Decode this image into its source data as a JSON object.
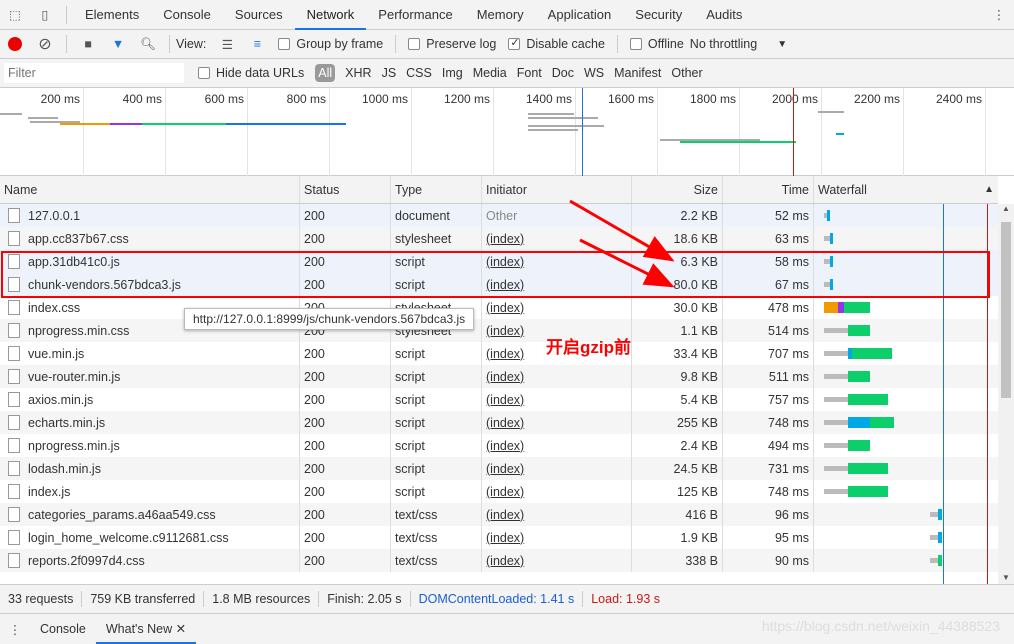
{
  "tabs": [
    "Elements",
    "Console",
    "Sources",
    "Network",
    "Performance",
    "Memory",
    "Application",
    "Security",
    "Audits"
  ],
  "active_tab": "Network",
  "toolbar": {
    "view_label": "View:",
    "group_by_frame": "Group by frame",
    "preserve_log": "Preserve log",
    "disable_cache": "Disable cache",
    "disable_cache_checked": true,
    "offline": "Offline",
    "throttling": "No throttling"
  },
  "filter": {
    "placeholder": "Filter",
    "hide_data_urls": "Hide data URLs",
    "types": [
      "All",
      "XHR",
      "JS",
      "CSS",
      "Img",
      "Media",
      "Font",
      "Doc",
      "WS",
      "Manifest",
      "Other"
    ]
  },
  "overview_ticks": [
    "200 ms",
    "400 ms",
    "600 ms",
    "800 ms",
    "1000 ms",
    "1200 ms",
    "1400 ms",
    "1600 ms",
    "1800 ms",
    "2000 ms",
    "2200 ms",
    "2400 ms"
  ],
  "columns": [
    "Name",
    "Status",
    "Type",
    "Initiator",
    "Size",
    "Time",
    "Waterfall"
  ],
  "rows": [
    {
      "name": "127.0.0.1",
      "status": "200",
      "type": "document",
      "initiator": "Other",
      "size": "2.2 KB",
      "time": "52 ms"
    },
    {
      "name": "app.cc837b67.css",
      "status": "200",
      "type": "stylesheet",
      "initiator": "(index)",
      "size": "18.6 KB",
      "time": "63 ms"
    },
    {
      "name": "app.31db41c0.js",
      "status": "200",
      "type": "script",
      "initiator": "(index)",
      "size": "6.3 KB",
      "time": "58 ms"
    },
    {
      "name": "chunk-vendors.567bdca3.js",
      "status": "200",
      "type": "script",
      "initiator": "(index)",
      "size": "80.0 KB",
      "time": "67 ms"
    },
    {
      "name": "index.css",
      "status": "200",
      "type": "stylesheet",
      "initiator": "(index)",
      "size": "30.0 KB",
      "time": "478 ms"
    },
    {
      "name": "nprogress.min.css",
      "status": "200",
      "type": "stylesheet",
      "initiator": "(index)",
      "size": "1.1 KB",
      "time": "514 ms"
    },
    {
      "name": "vue.min.js",
      "status": "200",
      "type": "script",
      "initiator": "(index)",
      "size": "33.4 KB",
      "time": "707 ms"
    },
    {
      "name": "vue-router.min.js",
      "status": "200",
      "type": "script",
      "initiator": "(index)",
      "size": "9.8 KB",
      "time": "511 ms"
    },
    {
      "name": "axios.min.js",
      "status": "200",
      "type": "script",
      "initiator": "(index)",
      "size": "5.4 KB",
      "time": "757 ms"
    },
    {
      "name": "echarts.min.js",
      "status": "200",
      "type": "script",
      "initiator": "(index)",
      "size": "255 KB",
      "time": "748 ms"
    },
    {
      "name": "nprogress.min.js",
      "status": "200",
      "type": "script",
      "initiator": "(index)",
      "size": "2.4 KB",
      "time": "494 ms"
    },
    {
      "name": "lodash.min.js",
      "status": "200",
      "type": "script",
      "initiator": "(index)",
      "size": "24.5 KB",
      "time": "731 ms"
    },
    {
      "name": "index.js",
      "status": "200",
      "type": "script",
      "initiator": "(index)",
      "size": "125 KB",
      "time": "748 ms"
    },
    {
      "name": "categories_params.a46aa549.css",
      "status": "200",
      "type": "text/css",
      "initiator": "(index)",
      "size": "416 B",
      "time": "96 ms"
    },
    {
      "name": "login_home_welcome.c9112681.css",
      "status": "200",
      "type": "text/css",
      "initiator": "(index)",
      "size": "1.9 KB",
      "time": "95 ms"
    },
    {
      "name": "reports.2f0997d4.css",
      "status": "200",
      "type": "text/css",
      "initiator": "(index)",
      "size": "338 B",
      "time": "90 ms"
    }
  ],
  "tooltip": "http://127.0.0.1:8999/js/chunk-vendors.567bdca3.js",
  "annotation": "开启gzip前",
  "status": {
    "requests": "33 requests",
    "transferred": "759 KB transferred",
    "resources": "1.8 MB resources",
    "finish": "Finish: 2.05 s",
    "dcl": "DOMContentLoaded: 1.41 s",
    "load": "Load: 1.93 s"
  },
  "drawer": {
    "tabs": [
      "Console",
      "What's New"
    ]
  },
  "watermark": "https://blog.csdn.net/weixin_44388523",
  "colors": {
    "accent": "#1a73e8",
    "dcl": "#1a5fd0",
    "load": "#c41a16",
    "record": "#e00000",
    "annotation": "#ff0000"
  }
}
